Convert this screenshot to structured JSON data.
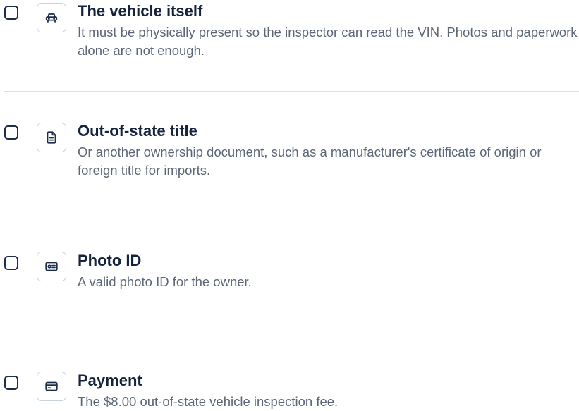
{
  "items": [
    {
      "title": "The vehicle itself",
      "description": "It must be physically present so the inspector can read the VIN. Photos and paperwork alone are not enough.",
      "icon": "car-icon",
      "checked": false
    },
    {
      "title": "Out-of-state title",
      "description": "Or another ownership document, such as a manufacturer's certificate of origin or foreign title for imports.",
      "icon": "document-icon",
      "checked": false
    },
    {
      "title": "Photo ID",
      "description": "A valid photo ID for the owner.",
      "icon": "id-card-icon",
      "checked": false
    },
    {
      "title": "Payment",
      "description": "The $8.00 out-of-state vehicle inspection fee.",
      "icon": "credit-card-icon",
      "checked": false
    }
  ],
  "colors": {
    "checkbox_border": "#1e2d4a",
    "icon_stroke": "#1e2d4a",
    "icon_box_border": "#c9d3df",
    "title": "#15233d",
    "description": "#5c6677",
    "divider": "#dde1e7"
  }
}
